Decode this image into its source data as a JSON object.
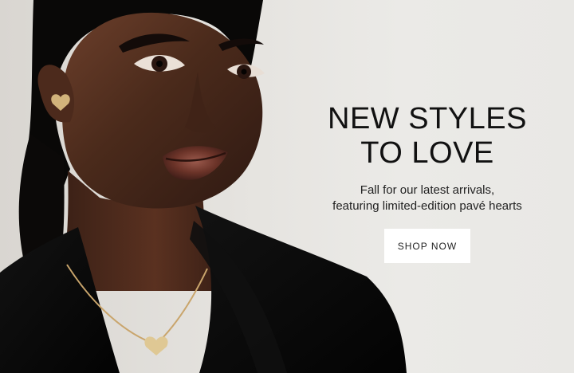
{
  "hero": {
    "headline_line1": "NEW STYLES",
    "headline_line2": "TO LOVE",
    "subtext_line1": "Fall for our latest arrivals,",
    "subtext_line2": "featuring limited-edition pavé hearts",
    "button_label": "SHOP NOW"
  },
  "colors": {
    "background": "#e8e7e4",
    "text": "#111111",
    "button": "#ffffff",
    "jacket": "#050505",
    "skin": "#4a2a1b",
    "gold": "#d2b37b"
  }
}
